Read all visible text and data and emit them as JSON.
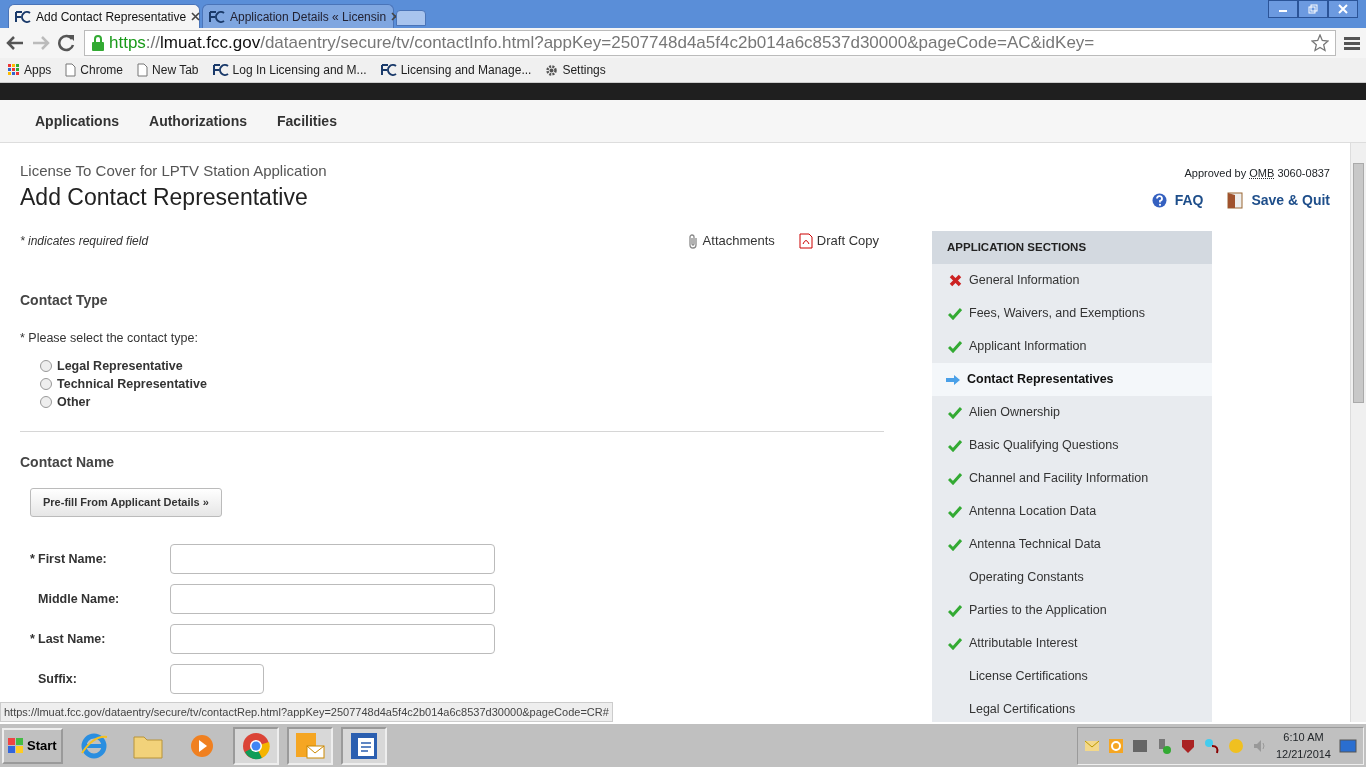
{
  "browser": {
    "tabs": [
      {
        "title": "Add Contact Representative",
        "selected": true
      },
      {
        "title": "Application Details « Licensin",
        "selected": false
      }
    ],
    "url": {
      "scheme": "https",
      "separator": "://",
      "host": "lmuat.fcc.gov",
      "path": "/dataentry/secure/tv/contactInfo.html?appKey=2507748d4a5f4c2b014a6c8537d30000&pageCode=AC&idKey="
    },
    "bookmarks": [
      {
        "label": "Apps",
        "kind": "apps"
      },
      {
        "label": "Chrome",
        "kind": "page"
      },
      {
        "label": "New Tab",
        "kind": "page"
      },
      {
        "label": "Log In Licensing and M...",
        "kind": "fcc"
      },
      {
        "label": "Licensing and Manage...",
        "kind": "fcc"
      },
      {
        "label": "Settings",
        "kind": "gear"
      }
    ],
    "status_url": "https://lmuat.fcc.gov/dataentry/secure/tv/contactRep.html?appKey=2507748d4a5f4c2b014a6c8537d30000&pageCode=CR#"
  },
  "nav": [
    {
      "label": "Applications"
    },
    {
      "label": "Authorizations"
    },
    {
      "label": "Facilities"
    }
  ],
  "page": {
    "subtitle": "License To Cover for LPTV Station Application",
    "title": "Add Contact Representative",
    "approved_prefix": "Approved by",
    "approved_abbr": "OMB",
    "approved_number": "3060-0837",
    "faq": "FAQ",
    "save_quit": "Save & Quit",
    "required_note": "* indicates required field",
    "attachments": "Attachments",
    "draft_copy": "Draft Copy"
  },
  "contact_type": {
    "heading": "Contact Type",
    "prompt": "* Please select the contact type:",
    "options": [
      {
        "label": "Legal Representative",
        "selected": false
      },
      {
        "label": "Technical Representative",
        "selected": false
      },
      {
        "label": "Other",
        "selected": false
      }
    ]
  },
  "contact_name": {
    "heading": "Contact Name",
    "prefill_button": "Pre-fill From Applicant Details »",
    "fields": [
      {
        "marker": "*",
        "label": "First Name:",
        "kind": "long"
      },
      {
        "label": "Middle Name:",
        "kind": "long"
      },
      {
        "marker": "*",
        "label": "Last Name:",
        "kind": "long"
      },
      {
        "label": "Suffix:",
        "kind": "short"
      }
    ]
  },
  "sections": {
    "heading": "APPLICATION SECTIONS",
    "items": [
      {
        "label": "General Information",
        "kind": "error"
      },
      {
        "label": "Fees, Waivers, and Exemptions",
        "kind": "done"
      },
      {
        "label": "Applicant Information",
        "kind": "done"
      },
      {
        "label": "Contact Representatives",
        "kind": "current"
      },
      {
        "label": "Alien Ownership",
        "kind": "done"
      },
      {
        "label": "Basic Qualifying Questions",
        "kind": "done"
      },
      {
        "label": "Channel and Facility Information",
        "kind": "done"
      },
      {
        "label": "Antenna Location Data",
        "kind": "done"
      },
      {
        "label": "Antenna Technical Data",
        "kind": "done"
      },
      {
        "label": "Operating Constants",
        "kind": "none"
      },
      {
        "label": "Parties to the Application",
        "kind": "done"
      },
      {
        "label": "Attributable Interest",
        "kind": "done"
      },
      {
        "label": "License Certifications",
        "kind": "none"
      },
      {
        "label": "Legal Certifications",
        "kind": "none"
      }
    ]
  },
  "taskbar": {
    "start": "Start",
    "apps": [
      {
        "kind": "ie",
        "active": false
      },
      {
        "kind": "folder",
        "active": false
      },
      {
        "kind": "media",
        "active": false
      },
      {
        "kind": "chrome",
        "active": true
      },
      {
        "kind": "outlook",
        "active": true
      },
      {
        "kind": "word",
        "active": true
      }
    ],
    "time": "6:10 AM",
    "date": "12/21/2014"
  }
}
